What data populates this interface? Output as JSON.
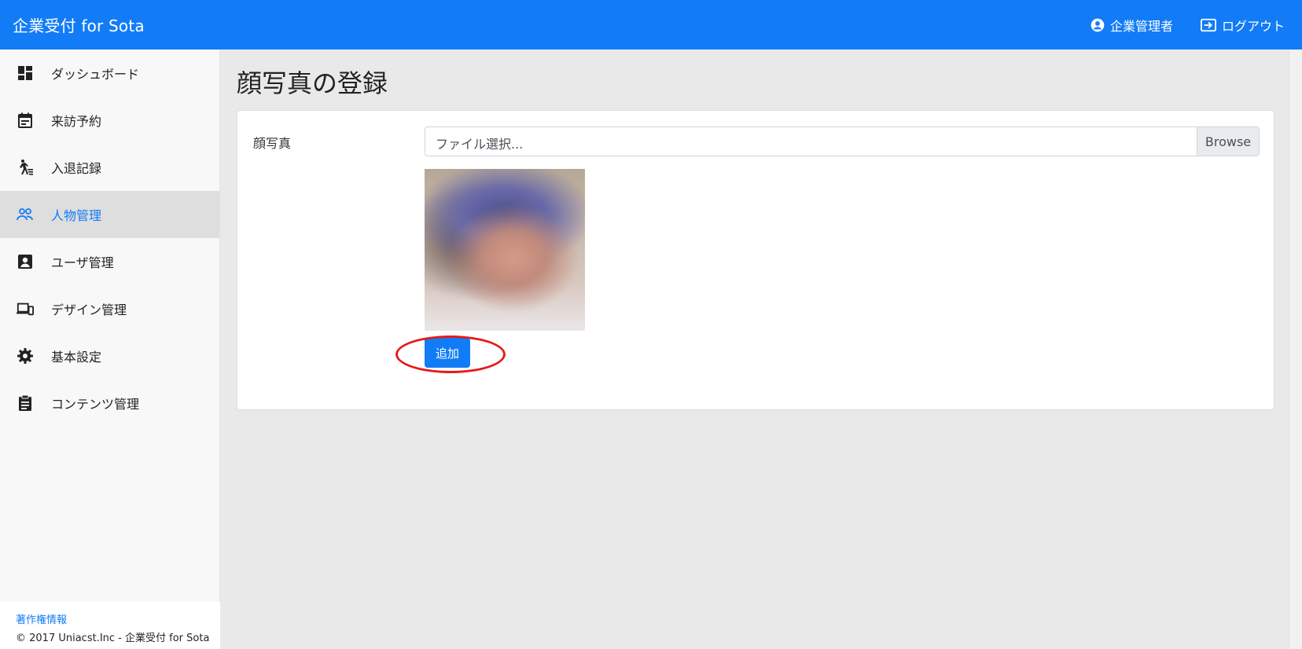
{
  "header": {
    "brand": "企業受付 for Sota",
    "user_label": "企業管理者",
    "logout_label": "ログアウト"
  },
  "sidebar": {
    "items": [
      {
        "label": "ダッシュボード",
        "icon": "dashboard-icon"
      },
      {
        "label": "来訪予約",
        "icon": "calendar-icon"
      },
      {
        "label": "入退記録",
        "icon": "walk-icon"
      },
      {
        "label": "人物管理",
        "icon": "people-icon",
        "active": true
      },
      {
        "label": "ユーザ管理",
        "icon": "user-card-icon"
      },
      {
        "label": "デザイン管理",
        "icon": "devices-icon"
      },
      {
        "label": "基本設定",
        "icon": "gear-icon"
      },
      {
        "label": "コンテンツ管理",
        "icon": "clipboard-icon"
      }
    ],
    "footer": {
      "link": "著作権情報",
      "copyright": "© 2017 Uniacst.Inc - 企業受付 for Sota"
    }
  },
  "main": {
    "title": "顔写真の登録",
    "field_label": "顔写真",
    "file_placeholder": "ファイル選択...",
    "browse_label": "Browse",
    "add_label": "追加"
  },
  "colors": {
    "accent": "#127cf7",
    "highlight": "#e31b1b"
  }
}
